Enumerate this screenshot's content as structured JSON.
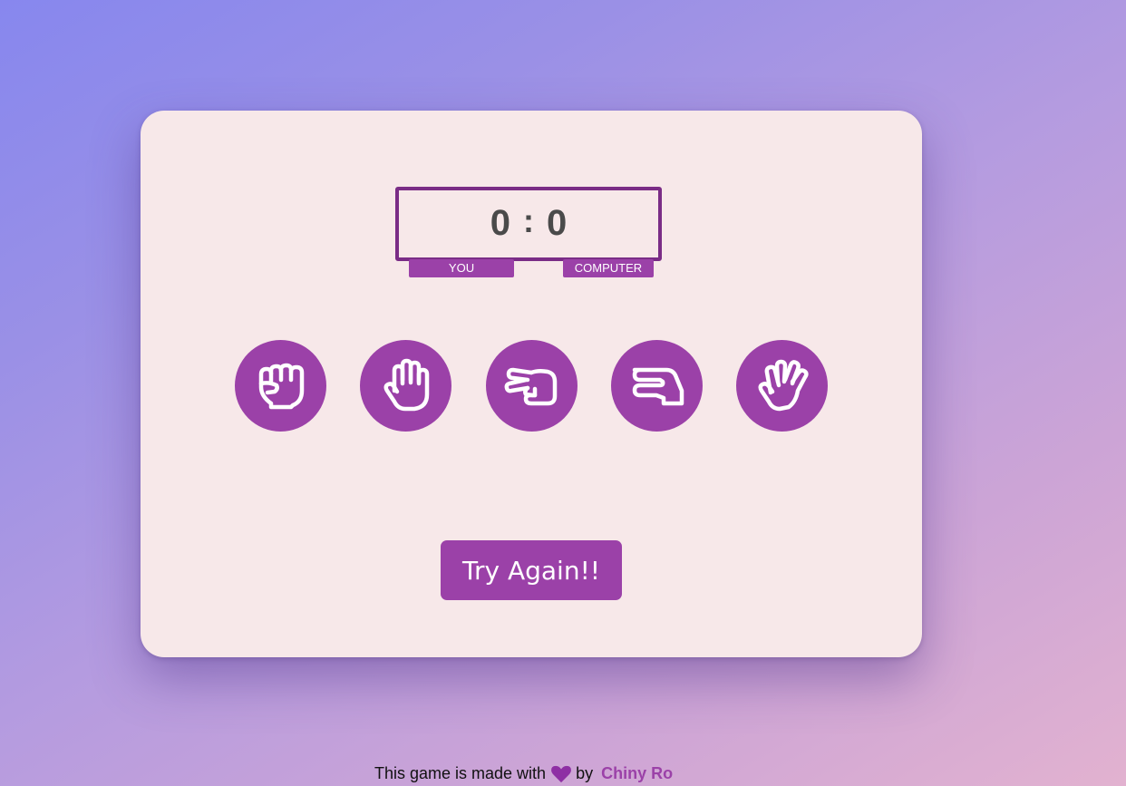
{
  "scoreboard": {
    "player_score": "0",
    "separator": ":",
    "computer_score": "0",
    "player_label": "YOU",
    "computer_label": "COMPUTER"
  },
  "choices": [
    {
      "name": "rock",
      "icon": "hand-rock-icon"
    },
    {
      "name": "paper",
      "icon": "hand-paper-icon"
    },
    {
      "name": "scissors",
      "icon": "hand-scissors-icon"
    },
    {
      "name": "lizard",
      "icon": "hand-lizard-icon"
    },
    {
      "name": "spock",
      "icon": "hand-spock-icon"
    }
  ],
  "actions": {
    "try_again_label": "Try Again!!"
  },
  "footer": {
    "text_before": "This game is made with",
    "icon": "heart-icon",
    "text_by": "by",
    "author": "Chiny Ro"
  },
  "colors": {
    "accent": "#9b41a8",
    "scoreboard_border": "#7a2c86",
    "card_background": "#f7e8e9",
    "score_text": "#4a4a4a"
  }
}
